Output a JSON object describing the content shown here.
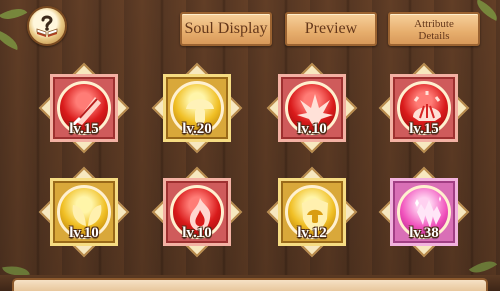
{
  "header": {
    "help_icon": "question-book-icon",
    "buttons": {
      "soul_display": "Soul Display",
      "preview": "Preview",
      "attribute_details_line1": "Attribute",
      "attribute_details_line2": "Details"
    }
  },
  "souls": [
    {
      "level": "lv.15",
      "rarity": "red",
      "icon": "feather-icon"
    },
    {
      "level": "lv.20",
      "rarity": "gold",
      "icon": "mushroom-icon"
    },
    {
      "level": "lv.10",
      "rarity": "red",
      "icon": "burst-icon"
    },
    {
      "level": "lv.15",
      "rarity": "red",
      "icon": "shell-icon"
    },
    {
      "level": "lv.10",
      "rarity": "gold",
      "icon": "wings-icon"
    },
    {
      "level": "lv.10",
      "rarity": "red",
      "icon": "flame-icon"
    },
    {
      "level": "lv.12",
      "rarity": "gold",
      "icon": "shield-mushroom-icon"
    },
    {
      "level": "lv.38",
      "rarity": "pink",
      "icon": "crystal-icon"
    }
  ],
  "colors": {
    "red": "#d91b1b",
    "gold": "#f0bf25",
    "pink": "#f051bb",
    "button": "#e7ae6d",
    "button_text": "#65381b"
  }
}
